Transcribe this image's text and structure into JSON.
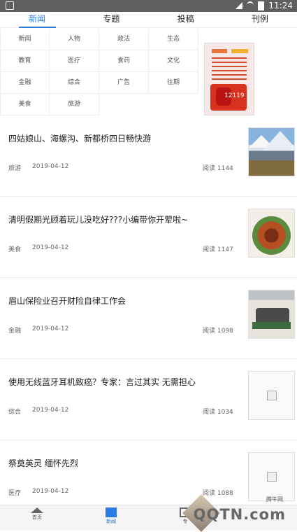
{
  "status": {
    "time": "11:24"
  },
  "tabs": [
    "新闻",
    "专题",
    "投稿",
    "刊例"
  ],
  "categories": [
    "新闻",
    "人物",
    "政法",
    "生态",
    "教育",
    "医疗",
    "食药",
    "文化",
    "金融",
    "综合",
    "广告",
    "往期",
    "美食",
    "旅游"
  ],
  "news": [
    {
      "title": "四姑娘山、海螺沟、新都桥四日畅快游",
      "cat": "旅游",
      "date": "2019-04-12",
      "reads": "阅读 1144",
      "img": "mountain"
    },
    {
      "title": "清明假期光顾着玩儿没吃好???小编带你开荤啦~",
      "cat": "美食",
      "date": "2019-04-12",
      "reads": "阅读 1147",
      "img": "food"
    },
    {
      "title": "眉山保险业召开财险自律工作会",
      "cat": "金融",
      "date": "2019-04-12",
      "reads": "阅读 1098",
      "img": "meeting"
    },
    {
      "title": "使用无线蓝牙耳机致癌？专家：言过其实 无需担心",
      "cat": "综合",
      "date": "2019-04-12",
      "reads": "阅读 1034",
      "img": "placeholder"
    },
    {
      "title": "祭奠英灵 缅怀先烈",
      "cat": "医疗",
      "date": "2019-04-12",
      "reads": "阅读 1088",
      "img": "placeholder"
    }
  ],
  "bottom": {
    "items": [
      "首页",
      "新闻",
      "专"
    ]
  },
  "watermark": {
    "site": "腾牛网",
    "text": "QQTN.com"
  },
  "banner": {
    "number": "12119"
  }
}
